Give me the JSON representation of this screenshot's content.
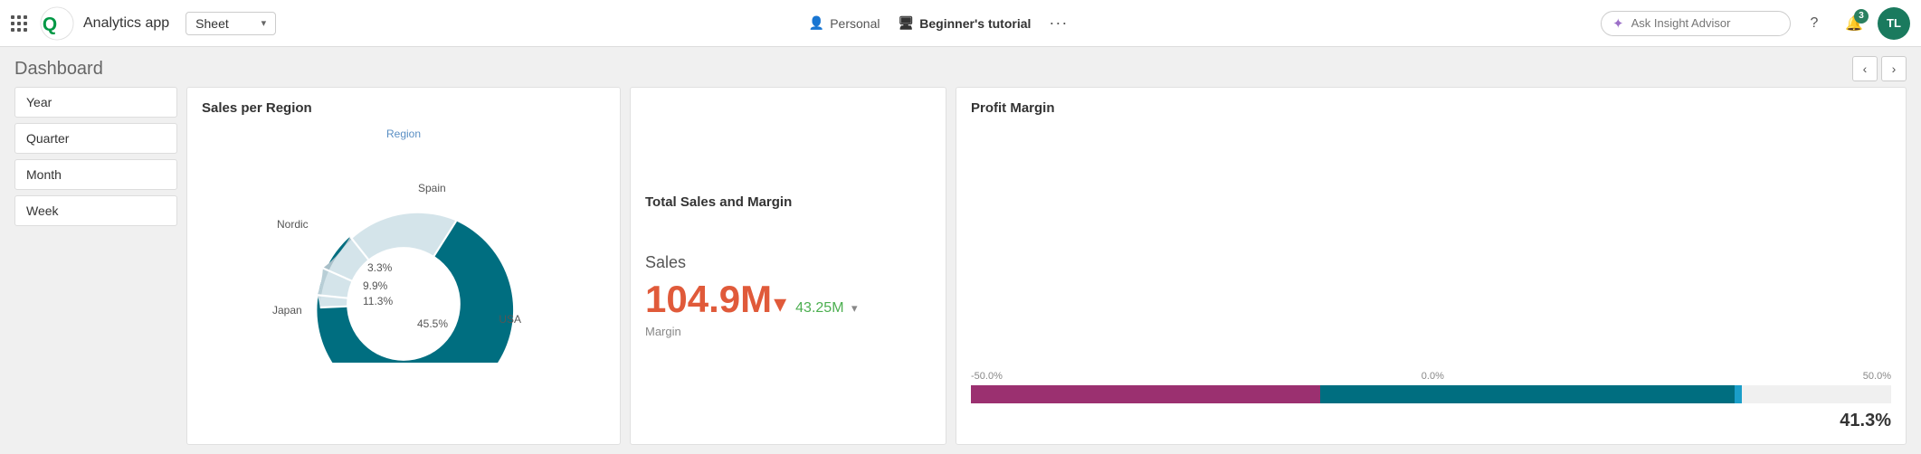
{
  "header": {
    "app_title": "Analytics app",
    "sheet_label": "Sheet",
    "personal_label": "Personal",
    "tutorial_label": "Beginner's tutorial",
    "insight_placeholder": "Ask Insight Advisor",
    "notification_count": "3",
    "avatar_initials": "TL"
  },
  "dashboard": {
    "title": "Dashboard",
    "nav_prev": "‹",
    "nav_next": "›"
  },
  "filters": [
    {
      "label": "Year"
    },
    {
      "label": "Quarter"
    },
    {
      "label": "Month"
    },
    {
      "label": "Week"
    }
  ],
  "sales_region": {
    "title": "Sales per Region",
    "region_label": "Region",
    "segments": [
      {
        "label": "USA",
        "pct": "45.5%",
        "color": "#006e80",
        "large": true
      },
      {
        "label": "Japan",
        "pct": "11.3%",
        "color": "#a8c4cc"
      },
      {
        "label": "Nordic",
        "pct": "9.9%",
        "color": "#b0cdd4"
      },
      {
        "label": "Spain",
        "pct": "3.3%",
        "color": "#c8d8dc"
      }
    ]
  },
  "total_sales": {
    "title": "Total Sales and Margin",
    "sales_label": "Sales",
    "sales_value": "104.9M",
    "margin_value": "43.25M",
    "margin_label": "Margin",
    "arrow": "▾"
  },
  "profit_margin": {
    "title": "Profit Margin",
    "axis_left": "-50.0%",
    "axis_mid": "0.0%",
    "axis_right": "50.0%",
    "value": "41.3%"
  }
}
